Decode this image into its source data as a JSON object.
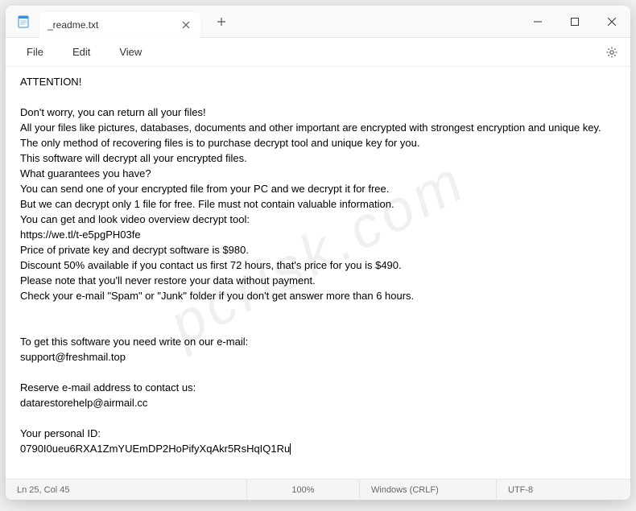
{
  "titlebar": {
    "tab_title": "_readme.txt"
  },
  "menu": {
    "file": "File",
    "edit": "Edit",
    "view": "View"
  },
  "content": {
    "text": "ATTENTION!\n\nDon't worry, you can return all your files!\nAll your files like pictures, databases, documents and other important are encrypted with strongest encryption and unique key.\nThe only method of recovering files is to purchase decrypt tool and unique key for you.\nThis software will decrypt all your encrypted files.\nWhat guarantees you have?\nYou can send one of your encrypted file from your PC and we decrypt it for free.\nBut we can decrypt only 1 file for free. File must not contain valuable information.\nYou can get and look video overview decrypt tool:\nhttps://we.tl/t-e5pgPH03fe\nPrice of private key and decrypt software is $980.\nDiscount 50% available if you contact us first 72 hours, that's price for you is $490.\nPlease note that you'll never restore your data without payment.\nCheck your e-mail \"Spam\" or \"Junk\" folder if you don't get answer more than 6 hours.\n\n\nTo get this software you need write on our e-mail:\nsupport@freshmail.top\n\nReserve e-mail address to contact us:\ndatarestorehelp@airmail.cc\n\nYour personal ID:\n0790I0ueu6RXA1ZmYUEmDP2HoPifyXqAkr5RsHqIQ1Ru"
  },
  "status": {
    "position": "Ln 25, Col 45",
    "zoom": "100%",
    "eol": "Windows (CRLF)",
    "encoding": "UTF-8"
  },
  "watermark": "pcrisk.com"
}
